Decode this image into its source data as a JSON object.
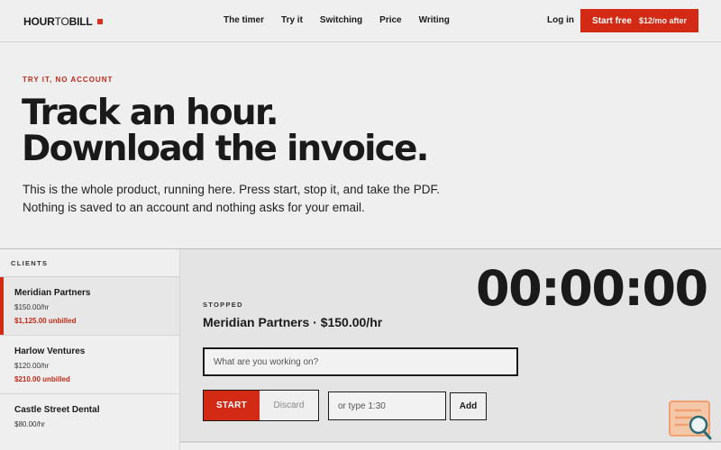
{
  "brand": {
    "name_part1": "HOUR",
    "name_part2": "TO",
    "name_part3": "BILL"
  },
  "nav": {
    "links": [
      "The timer",
      "Try it",
      "Switching",
      "Price",
      "Writing"
    ],
    "login": "Log in",
    "cta_main": "Start free",
    "cta_sub": "$12/mo after"
  },
  "hero": {
    "eyebrow": "TRY IT, NO ACCOUNT",
    "headline_line1": "Track an hour.",
    "headline_line2": "Download the invoice.",
    "lede_line1": "This is the whole product, running here. Press start, stop it, and take the PDF.",
    "lede_line2": "Nothing is saved to an account and nothing asks for your email."
  },
  "sidebar": {
    "heading": "CLIENTS",
    "clients": [
      {
        "name": "Meridian Partners",
        "rate": "$150.00/hr",
        "unbilled": "$1,125.00 unbilled"
      },
      {
        "name": "Harlow Ventures",
        "rate": "$120.00/hr",
        "unbilled": "$210.00 unbilled"
      },
      {
        "name": "Castle Street Dental",
        "rate": "$80.00/hr",
        "unbilled": ""
      }
    ]
  },
  "timer": {
    "status": "STOPPED",
    "current_client": "Meridian Partners · $150.00/hr",
    "clock": "00:00:00",
    "work_placeholder": "What are you working on?",
    "start_label": "START",
    "discard_label": "Discard",
    "manual_placeholder": "or type 1:30",
    "add_label": "Add"
  },
  "colors": {
    "accent": "#d32a16",
    "ink": "#1a1a1a",
    "background": "#efefef",
    "panel": "#e4e4e4",
    "widget": "#f0a878"
  },
  "icons": {
    "corner_widget": "search-document-icon"
  }
}
